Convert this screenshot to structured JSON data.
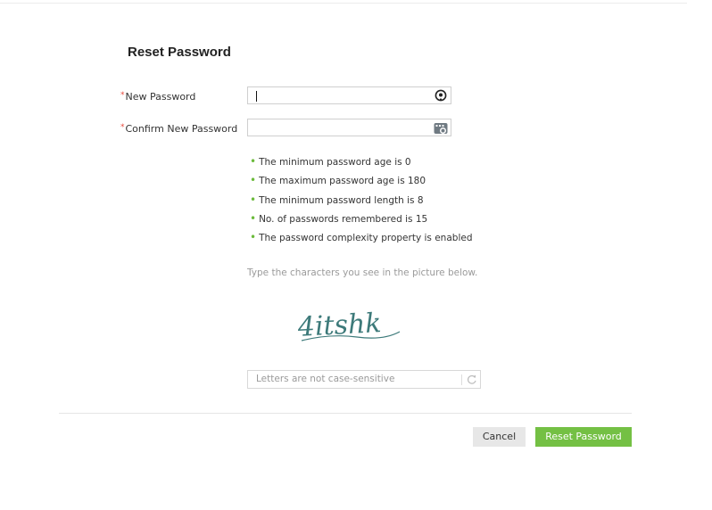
{
  "page": {
    "title": "Reset Password"
  },
  "form": {
    "new_password_label": "New Password",
    "confirm_password_label": "Confirm New Password",
    "required_marker": "*",
    "new_password_value": "",
    "confirm_password_value": ""
  },
  "icons": {
    "reveal": "eye-icon",
    "keyboard": "virtual-keyboard-icon",
    "refresh": "refresh-icon"
  },
  "policy": {
    "bullet": "•",
    "rules": [
      "The minimum password age is 0",
      "The maximum password age is 180",
      "The minimum password length is 8",
      "No. of passwords remembered is 15",
      "The password complexity property is enabled"
    ]
  },
  "captcha": {
    "hint": "Type the characters you see in the picture below.",
    "text": "4itshk",
    "placeholder": "Letters are not case-sensitive",
    "color": "#3d7a7a"
  },
  "actions": {
    "cancel_label": "Cancel",
    "reset_label": "Reset Password"
  },
  "colors": {
    "accent_green": "#74c044",
    "required_red": "#e8493c",
    "bullet_green": "#6cbb3c"
  }
}
